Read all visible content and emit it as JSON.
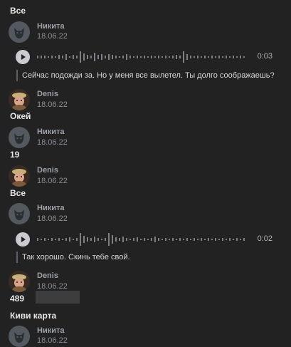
{
  "messages": {
    "m1_text": "Все",
    "m2_author": "Никита",
    "m2_date": "18.06.22",
    "m2_audio_duration": "0:03",
    "m2_caption": "Сейчас подожди за. Но у меня все вылетел. Ты долго соображаешь?",
    "m3_author": "Denis",
    "m3_date": "18.06.22",
    "m3_text": "Окей",
    "m4_author": "Никита",
    "m4_date": "18.06.22",
    "m4_text": "19",
    "m5_author": "Denis",
    "m5_date": "18.06.22",
    "m5_text": "Все",
    "m6_author": "Никита",
    "m6_date": "18.06.22",
    "m6_audio_duration": "0:02",
    "m6_caption": "Так хорошо. Скинь тебе свой.",
    "m7_author": "Denis",
    "m7_date": "18.06.22",
    "m7_text": "489",
    "m7_text2": "Киви карта",
    "m8_author": "Никита",
    "m8_date": "18.06.22"
  },
  "colors": {
    "background": "#222222",
    "text": "#e1e3e6",
    "muted": "#8a8f95"
  },
  "icons": {
    "avatar_nikita": "dog-avatar-icon",
    "avatar_denis": "person-avatar-icon",
    "play": "play-icon"
  }
}
